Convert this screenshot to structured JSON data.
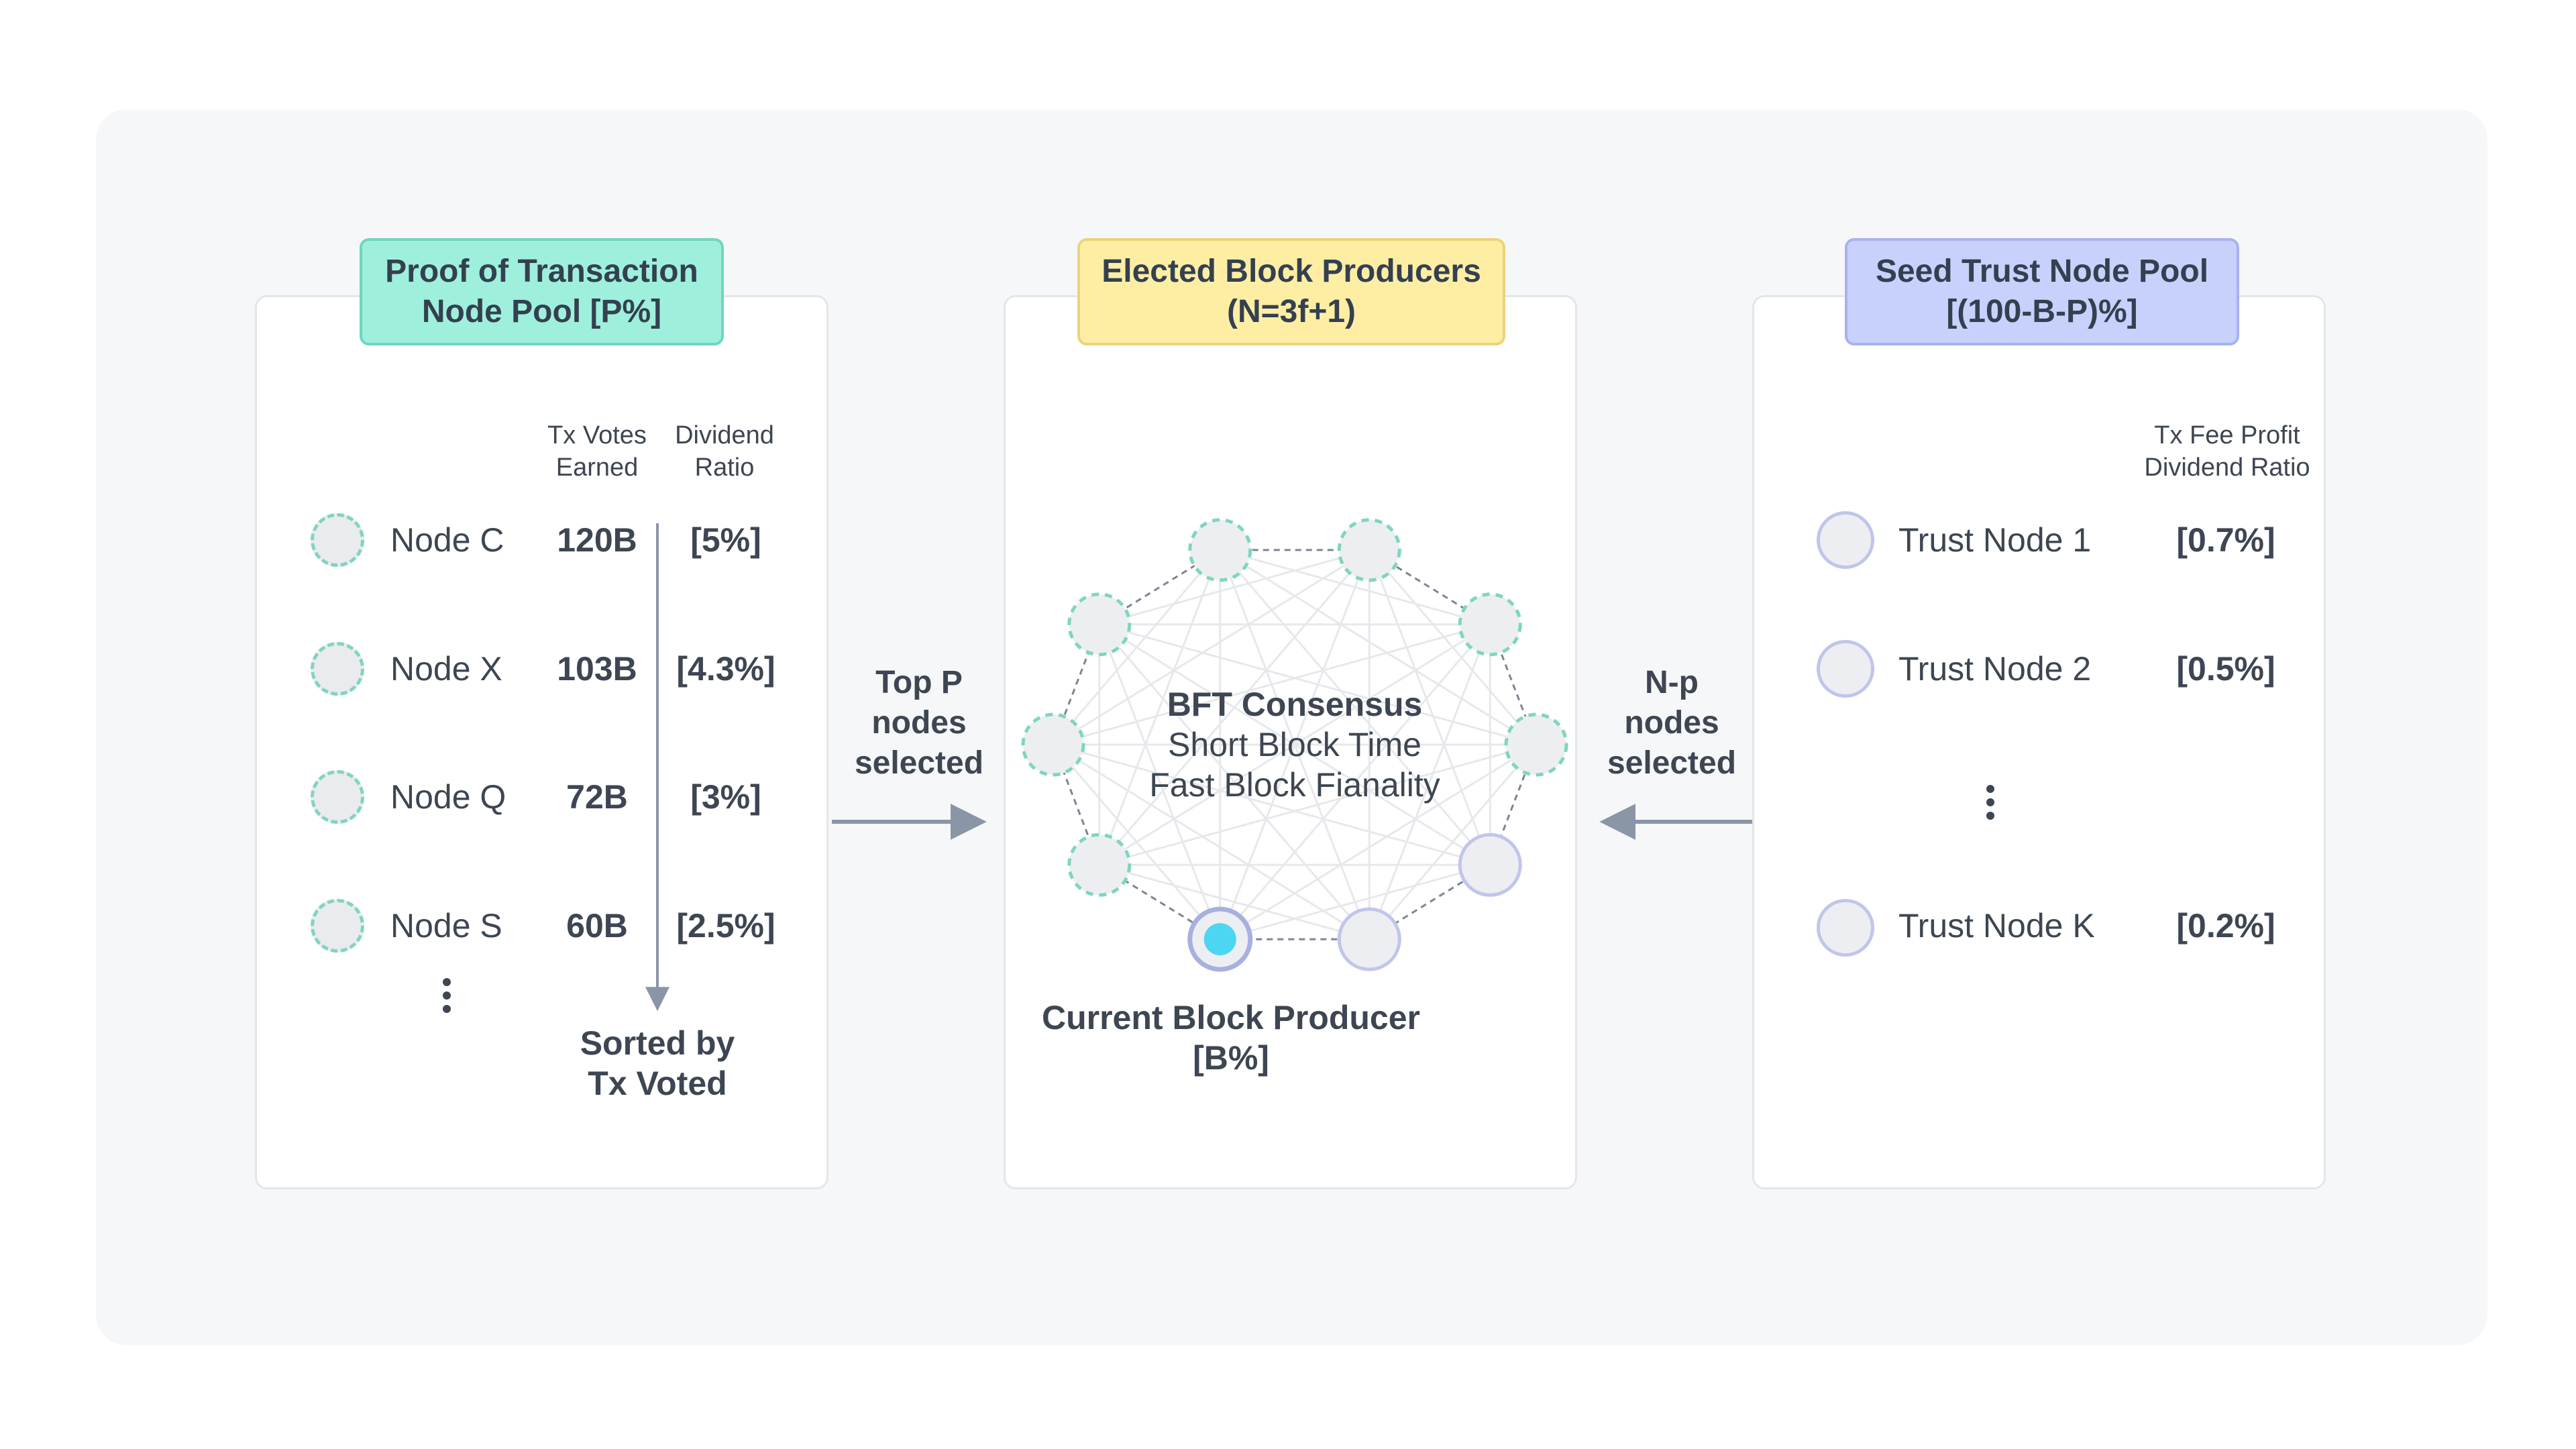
{
  "left_pool": {
    "title_line1": "Proof of Transaction",
    "title_line2": "Node Pool [P%]",
    "col_votes": "Tx Votes\nEarned",
    "col_dividend": "Dividend\nRatio",
    "nodes": [
      {
        "name": "Node C",
        "votes": "120B",
        "ratio": "[5%]"
      },
      {
        "name": "Node X",
        "votes": "103B",
        "ratio": "[4.3%]"
      },
      {
        "name": "Node Q",
        "votes": "72B",
        "ratio": "[3%]"
      },
      {
        "name": "Node S",
        "votes": "60B",
        "ratio": "[2.5%]"
      }
    ],
    "sort_line1": "Sorted by",
    "sort_line2": "Tx Voted"
  },
  "middle_pool": {
    "title_line1": "Elected Block Producers",
    "title_line2": "(N=3f+1)",
    "consensus_line1": "BFT Consensus",
    "consensus_line2": "Short Block Time",
    "consensus_line3": "Fast Block Fianality",
    "producer_line1": "Current Block Producer",
    "producer_line2": "[B%]"
  },
  "right_pool": {
    "title_line1": "Seed Trust Node Pool",
    "title_line2": "[(100-B-P)%]",
    "col_header": "Tx Fee Profit\nDividend Ratio",
    "nodes": [
      {
        "name": "Trust Node 1",
        "ratio": "[0.7%]"
      },
      {
        "name": "Trust Node 2",
        "ratio": "[0.5%]"
      },
      {
        "name": "Trust Node K",
        "ratio": "[0.2%]"
      }
    ]
  },
  "arrows": {
    "left_line1": "Top P",
    "left_line2": "nodes",
    "left_line3": "selected",
    "right_line1": "N-p",
    "right_line2": "nodes",
    "right_line3": "selected"
  },
  "colors": {
    "pot_tag": "#9ef0dc",
    "elected_tag": "#fdeea4",
    "seed_tag": "#c8d1fb",
    "current_producer": "#4dd6f2",
    "pot_node_border": "#7ed6bd",
    "trust_node_border": "#c0c6ea"
  }
}
